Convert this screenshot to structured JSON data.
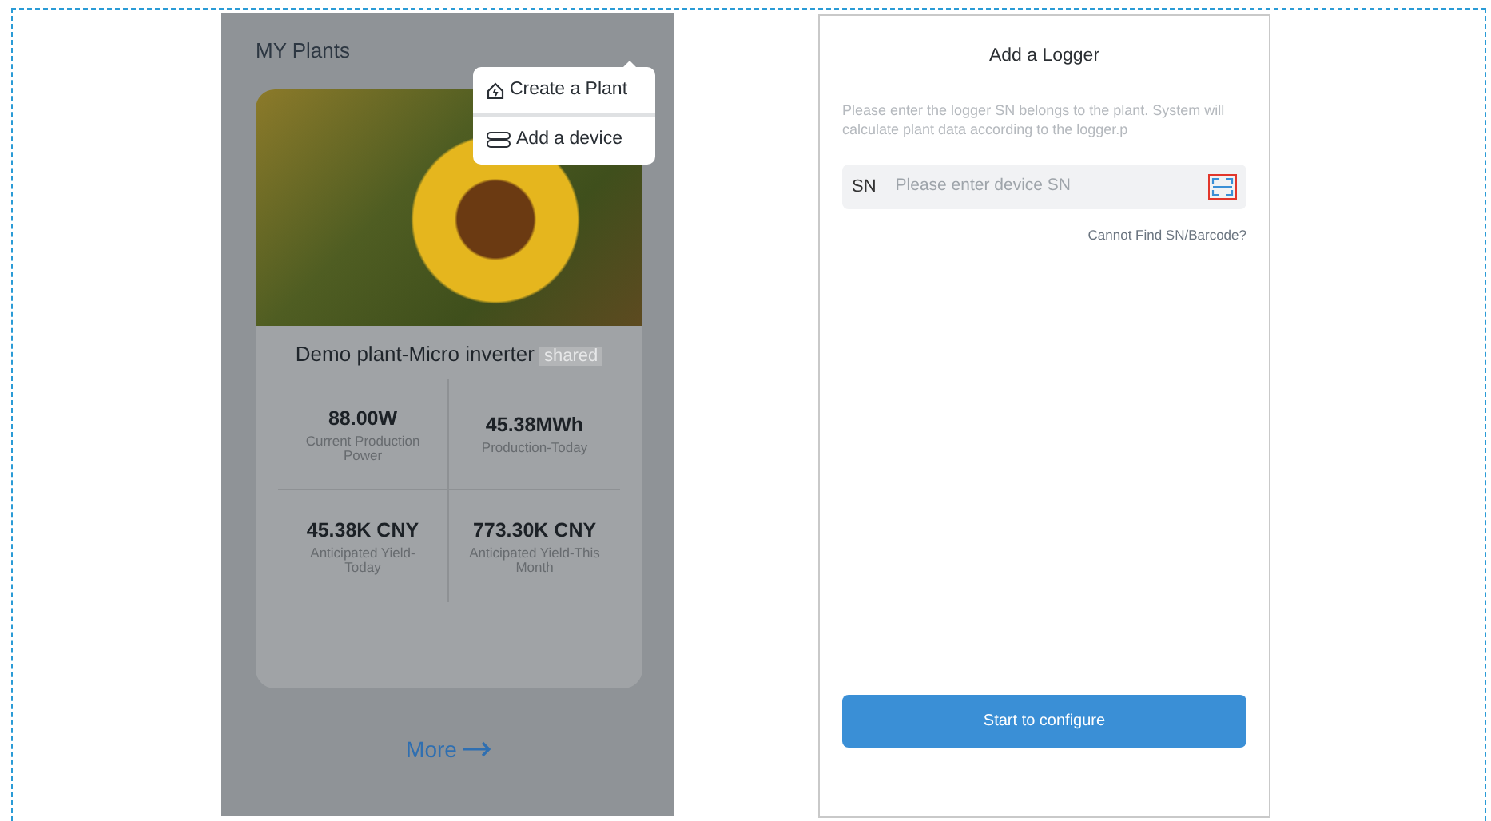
{
  "plants_screen": {
    "title": "MY Plants",
    "menu": [
      {
        "kind": "plant",
        "label": "Create a Plant"
      },
      {
        "kind": "device",
        "label": "Add a device"
      }
    ],
    "plant": {
      "name": "Demo plant-Micro inverter",
      "tag": "shared",
      "stats": [
        {
          "value": "88.00W",
          "label": "Current Production Power"
        },
        {
          "value": "45.38MWh",
          "label": "Production-Today"
        },
        {
          "value": "45.38K CNY",
          "label": "Anticipated Yield-Today"
        },
        {
          "value": "773.30K CNY",
          "label": "Anticipated Yield-This Month"
        }
      ]
    },
    "more": "More"
  },
  "logger_screen": {
    "title": "Add a Logger",
    "hint": "Please enter the logger SN belongs to the plant. System will  calculate plant data according to the logger.p",
    "sn_label": "SN",
    "placeholder": "Please enter device SN",
    "help_link": "Cannot Find SN/Barcode?",
    "button": "Start to configure"
  }
}
